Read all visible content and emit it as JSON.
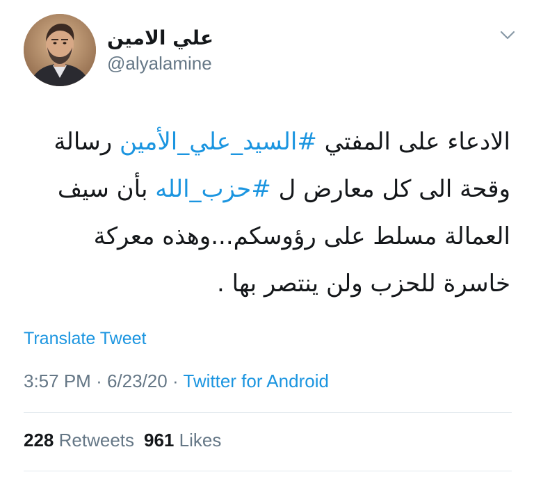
{
  "tweet": {
    "author": {
      "display_name": "علي الامين",
      "handle": "@alyalamine",
      "avatar_icon": "avatar-photo"
    },
    "menu_icon": "chevron-down-icon",
    "text_parts": [
      "الادعاء على المفتي ",
      "#السيد_علي_الأمين",
      " رسالة وقحة  الى كل معارض ل ",
      "#حزب_الله",
      " بأن سيف العمالة مسلط على رؤوسكم...وهذه معركة خاسرة للحزب ولن ينتصر بها ."
    ],
    "translate_label": "Translate Tweet",
    "meta": {
      "time": "3:57 PM",
      "separator": "·",
      "date": "6/23/20",
      "source": "Twitter for Android"
    },
    "stats": {
      "retweets_count": "228",
      "retweets_label": "Retweets",
      "likes_count": "961",
      "likes_label": "Likes"
    }
  },
  "colors": {
    "link": "#1b95e0",
    "text": "#14171a",
    "secondary": "#657786",
    "divider": "#e1e8ed"
  }
}
